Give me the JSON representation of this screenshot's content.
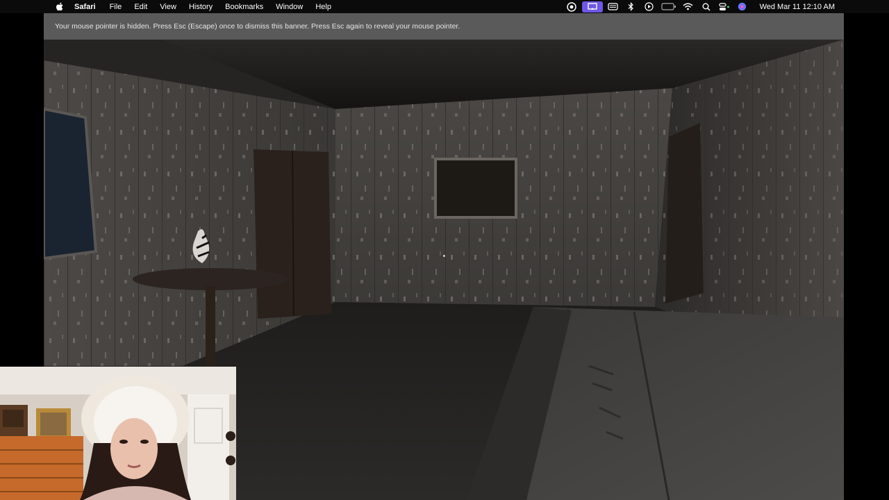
{
  "menubar": {
    "app_name": "Safari",
    "menus": [
      "File",
      "Edit",
      "View",
      "History",
      "Bookmarks",
      "Window",
      "Help"
    ],
    "status_icons": [
      "siri-colorful-icon",
      "screen-mirroring-icon",
      "keyboard-icon",
      "bluetooth-icon",
      "play-icon",
      "battery-icon",
      "wifi-icon",
      "search-icon",
      "control-center-icon",
      "siri-icon"
    ],
    "clock": "Wed Mar 11  12:10 AM"
  },
  "game": {
    "banner_text": "Your mouse pointer is hidden. Press Esc (Escape) once to dismiss this banner. Press Esc again to reveal your mouse pointer."
  }
}
